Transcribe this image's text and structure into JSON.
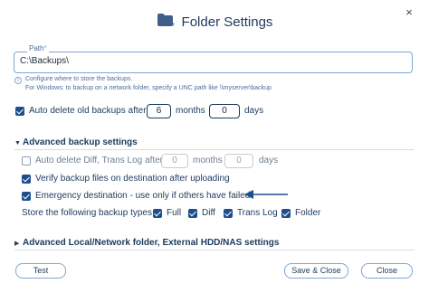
{
  "dialog": {
    "title": "Folder Settings",
    "close_glyph": "×"
  },
  "path": {
    "label": "Path",
    "required_mark": "*",
    "value": "C:\\Backups\\",
    "hint_line1": "Configure where to store the backups.",
    "hint_line2": "For Windows: to backup on a network folder, specify a UNC path like \\\\myserver\\backup"
  },
  "auto_delete": {
    "checked": true,
    "label_before": "Auto delete old backups after",
    "months_value": "6",
    "months_label": "months",
    "days_value": "0",
    "days_label": "days"
  },
  "advanced": {
    "section_title": "Advanced backup settings",
    "auto_delete_diff": {
      "checked": false,
      "label_before": "Auto delete Diff, Trans Log after",
      "months_value": "0",
      "months_label": "months",
      "days_value": "0",
      "days_label": "days"
    },
    "verify": {
      "checked": true,
      "label": "Verify backup files on destination after uploading"
    },
    "emergency": {
      "checked": true,
      "label": "Emergency destination - use only if others have failed"
    },
    "types_label": "Store the following backup types:",
    "types": [
      {
        "label": "Full",
        "checked": true
      },
      {
        "label": "Diff",
        "checked": true
      },
      {
        "label": "Trans Log",
        "checked": true
      },
      {
        "label": "Folder",
        "checked": true
      }
    ]
  },
  "advanced_local": {
    "section_title": "Advanced Local/Network folder, External HDD/NAS settings"
  },
  "buttons": {
    "test": "Test",
    "save_close": "Save & Close",
    "close": "Close"
  },
  "colors": {
    "accent": "#1d4f8c",
    "text": "#1b3a5c",
    "border": "#7fa6d4"
  }
}
